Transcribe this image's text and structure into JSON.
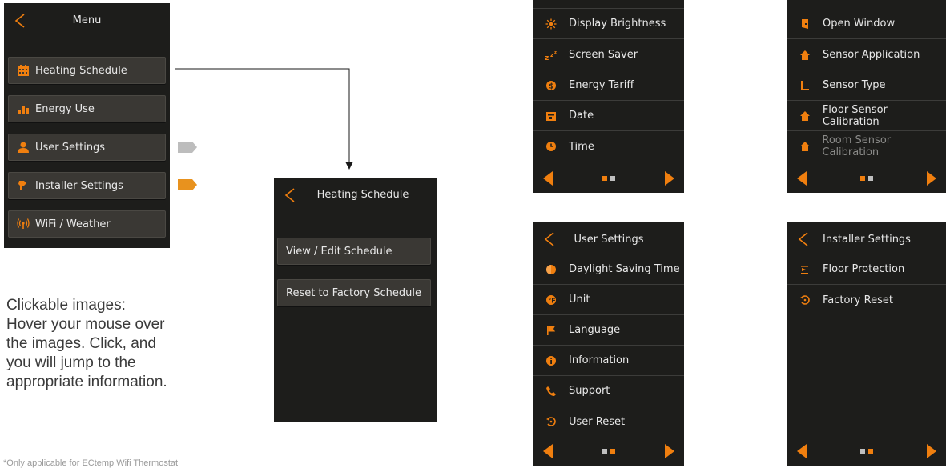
{
  "main_menu": {
    "title": "Menu",
    "items": [
      {
        "label": "Heating Schedule",
        "icon": "calendar-icon"
      },
      {
        "label": "Energy Use",
        "icon": "bar-chart-icon"
      },
      {
        "label": "User Settings",
        "icon": "user-icon"
      },
      {
        "label": "Installer Settings",
        "icon": "wrench-icon"
      },
      {
        "label": "WiFi / Weather",
        "icon": "wifi-icon"
      }
    ]
  },
  "heating_schedule": {
    "title": "Heating Schedule",
    "items": [
      {
        "label": "View / Edit Schedule"
      },
      {
        "label": "Reset to Factory Schedule"
      }
    ]
  },
  "user_settings_p2": {
    "items": [
      {
        "label": "Display Brightness",
        "icon": "brightness-icon"
      },
      {
        "label": "Screen Saver",
        "icon": "sleep-icon"
      },
      {
        "label": "Energy Tariff",
        "icon": "tariff-icon"
      },
      {
        "label": "Date",
        "icon": "calendar-icon"
      },
      {
        "label": "Time",
        "icon": "clock-icon"
      }
    ],
    "page_indicator": "2 of 2"
  },
  "installer_settings_p2": {
    "items": [
      {
        "label": "Open Window",
        "icon": "window-icon"
      },
      {
        "label": "Sensor Application",
        "icon": "house-icon"
      },
      {
        "label": "Sensor Type",
        "icon": "sensor-icon"
      },
      {
        "label": "Floor Sensor Calibration",
        "icon": "house-icon"
      },
      {
        "label": "Room Sensor Calibration",
        "icon": "house-icon",
        "dimmed": true
      }
    ]
  },
  "user_settings_p1": {
    "title": "User Settings",
    "items": [
      {
        "label": "Daylight Saving Time",
        "icon": "half-circle-icon"
      },
      {
        "label": "Unit",
        "icon": "unit-icon"
      },
      {
        "label": "Language",
        "icon": "flag-icon"
      },
      {
        "label": "Information",
        "icon": "info-icon"
      },
      {
        "label": "Support",
        "icon": "phone-icon"
      },
      {
        "label": "User Reset",
        "icon": "reset-icon"
      }
    ]
  },
  "installer_settings_p1": {
    "title": "Installer Settings",
    "items": [
      {
        "label": "Floor Protection",
        "icon": "floor-protection-icon"
      },
      {
        "label": "Factory Reset",
        "icon": "reset-icon"
      }
    ]
  },
  "note": {
    "line1": "Clickable images:",
    "line2": "Hover your mouse over",
    "line3": "the images. Click, and",
    "line4": "you will jump to the",
    "line5": "appropriate information."
  },
  "footnote": "*Only applicable for ECtemp Wifi Thermostat",
  "colors": {
    "accent": "#f07f0f",
    "panel_bg": "#1d1d1b",
    "button_bg": "#3a3834",
    "tag_user": "#bdbdbd",
    "tag_installer": "#e8921e"
  }
}
